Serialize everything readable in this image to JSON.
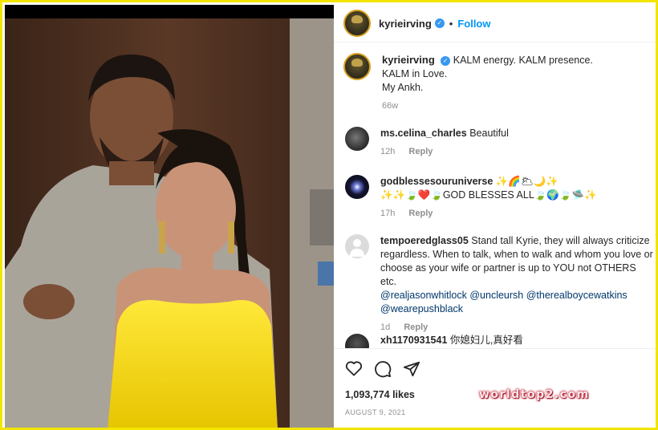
{
  "post": {
    "username": "kyrieirving",
    "verified": true,
    "follow_label": "Follow",
    "caption_lines": [
      "KALM energy. KALM presence.",
      "KALM in Love.",
      "My Ankh."
    ],
    "caption_time": "66w"
  },
  "comments": [
    {
      "username": "ms.celina_charles",
      "text": "Beautiful",
      "time": "12h",
      "reply_label": "Reply",
      "avatar_color": "#3a3a3a"
    },
    {
      "username": "godblessesouruniverse",
      "text": "✨🌈🌥🌙✨",
      "text2": "✨✨🍃❤️🍃GOD BLESSES ALL🍃🌍🍃🛸✨",
      "time": "17h",
      "reply_label": "Reply",
      "avatar_color": "#0c0c1e"
    },
    {
      "username": "tempoeredglass05",
      "text": "Stand tall Kyrie, they will always criticize regardless. When to talk, when to walk and whom you love or choose as your wife or partner is up to YOU not OTHERS etc.",
      "mentions": [
        "@realjasonwhitlock",
        "@uncleursh",
        "@therealboycewatkins",
        "@wearepushblack"
      ],
      "time": "1d",
      "reply_label": "Reply",
      "avatar_color": "#dbdbdb"
    },
    {
      "username": "xh1170931541",
      "text": "你媳妇儿,真好看",
      "avatar_color": "#222222"
    }
  ],
  "actions": {
    "like_icon": "heart-icon",
    "comment_icon": "comment-icon",
    "share_icon": "paper-plane-icon"
  },
  "likes": "1,093,774 likes",
  "date": "AUGUST 9, 2021",
  "watermark": "worldtop2.com",
  "colors": {
    "frame": "#f2e500",
    "follow": "#0095f6",
    "verified": "#3897f0",
    "dress": "#f2d500"
  }
}
